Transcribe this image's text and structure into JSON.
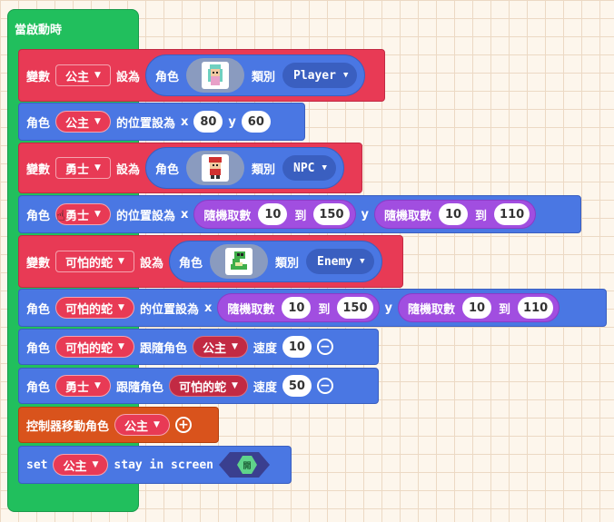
{
  "hat": {
    "label": "當啟動時"
  },
  "common": {
    "variable": "變數",
    "set_to": "設為",
    "sprite": "角色",
    "kind": "類別",
    "set_position": "的位置設為",
    "x": "x",
    "y": "y",
    "random": "隨機取數",
    "to": "到",
    "follow": "跟隨角色",
    "speed": "速度"
  },
  "block1": {
    "var": "公主",
    "kind_value": "Player"
  },
  "block2": {
    "var": "公主",
    "x": "80",
    "y": "60"
  },
  "block3": {
    "var": "勇士",
    "kind_value": "NPC"
  },
  "block4": {
    "var": "勇士",
    "x_from": "10",
    "x_to": "150",
    "y_from": "10",
    "y_to": "110"
  },
  "block5": {
    "var": "可怕的蛇",
    "kind_value": "Enemy"
  },
  "block6": {
    "var": "可怕的蛇",
    "x_from": "10",
    "x_to": "150",
    "y_from": "10",
    "y_to": "110"
  },
  "block7": {
    "var": "可怕的蛇",
    "target": "公主",
    "speed": "10"
  },
  "block8": {
    "var": "勇士",
    "target": "可怕的蛇",
    "speed": "50"
  },
  "block9": {
    "label": "控制器移動角色",
    "var": "公主"
  },
  "block10": {
    "set": "set",
    "var": "公主",
    "suffix": "stay in screen",
    "toggle": "開"
  },
  "icons": {
    "caret": "▼",
    "minus": "−",
    "plus": "+",
    "cursor": "☝"
  }
}
